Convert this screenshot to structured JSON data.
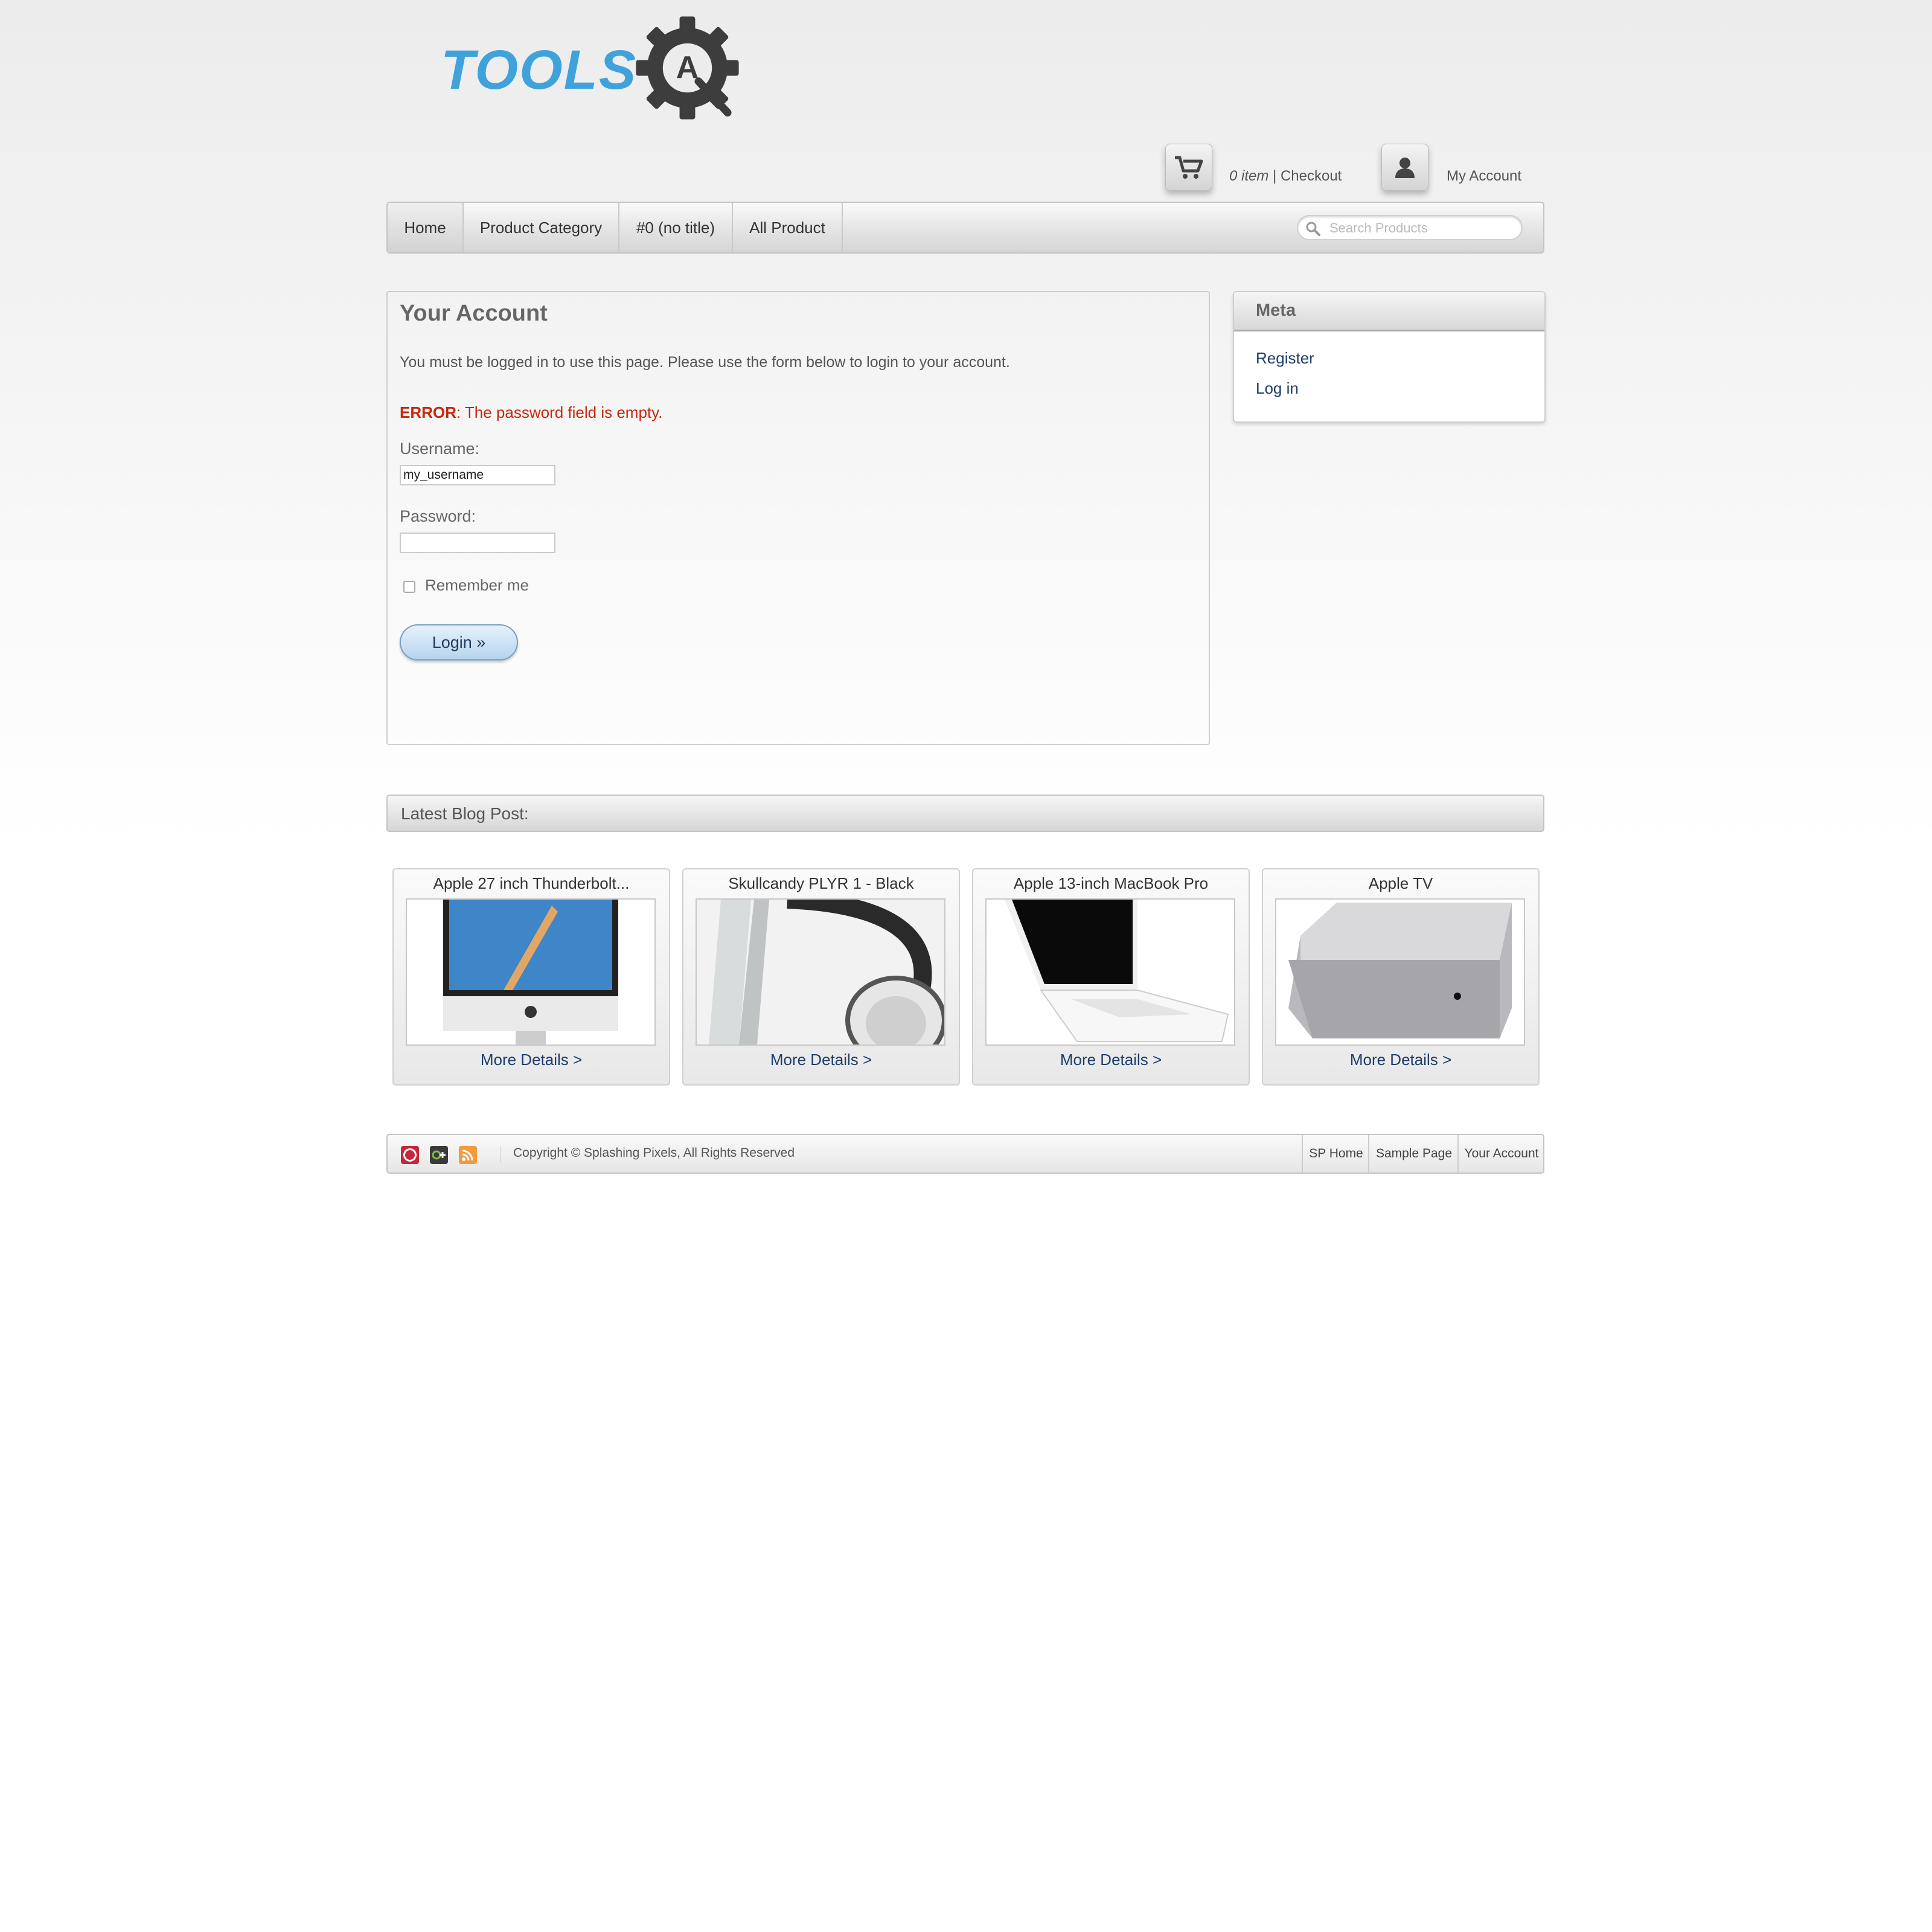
{
  "logo": {
    "text": "TOOLS",
    "gear_letter": "A"
  },
  "header": {
    "cart_count": "0 item",
    "cart_sep": " | ",
    "checkout": "Checkout",
    "account": "My Account"
  },
  "nav": {
    "items": [
      {
        "label": "Home"
      },
      {
        "label": "Product Category"
      },
      {
        "label": "#0 (no title)"
      },
      {
        "label": "All Product"
      }
    ],
    "search_placeholder": "Search Products"
  },
  "account_panel": {
    "title": "Your Account",
    "message": "You must be logged in to use this page. Please use the form below to login to your account.",
    "error_label": "ERROR",
    "error_text": ": The password field is empty.",
    "username_label": "Username:",
    "username_value": "my_username",
    "password_label": "Password:",
    "password_value": "",
    "remember_label": "Remember me",
    "remember_checked": false,
    "login_button": "Login »"
  },
  "meta": {
    "title": "Meta",
    "links": [
      {
        "label": "Register"
      },
      {
        "label": "Log in"
      }
    ]
  },
  "blog": {
    "title": "Latest Blog Post:"
  },
  "products": [
    {
      "name": "Apple 27 inch Thunderbolt...",
      "more": "More Details >",
      "image_icon": "imac-image"
    },
    {
      "name": "Skullcandy PLYR 1 - Black",
      "more": "More Details >",
      "image_icon": "headphones-image"
    },
    {
      "name": "Apple 13-inch MacBook Pro",
      "more": "More Details >",
      "image_icon": "macbook-image"
    },
    {
      "name": "Apple TV",
      "more": "More Details >",
      "image_icon": "mac-mini-image"
    }
  ],
  "footer": {
    "social_icons": [
      "pinterest-icon",
      "google-plus-icon",
      "rss-icon"
    ],
    "copyright": "Copyright © Splashing Pixels, All Rights Reserved",
    "links": [
      {
        "label": "SP Home"
      },
      {
        "label": "Sample Page"
      },
      {
        "label": "Your Account"
      }
    ]
  },
  "colors": {
    "logo_blue": "#3fa2db",
    "error_red": "#c5280f",
    "link_blue": "#1f3d6b"
  }
}
